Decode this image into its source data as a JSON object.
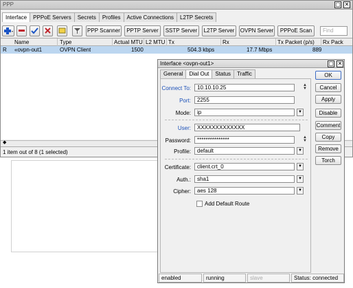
{
  "main_window": {
    "title": "PPP",
    "tabs": [
      "Interface",
      "PPPoE Servers",
      "Secrets",
      "Profiles",
      "Active Connections",
      "L2TP Secrets"
    ],
    "toolbar": {
      "buttons": [
        "PPP Scanner",
        "PPTP Server",
        "SSTP Server",
        "L2TP Server",
        "OVPN Server",
        "PPPoE Scan"
      ],
      "find_placeholder": "Find"
    },
    "table": {
      "columns": [
        "Name",
        "Type",
        "Actual MTU",
        "L2 MTU",
        "Tx",
        "Rx",
        "Tx Packet (p/s)",
        "Rx Pack"
      ],
      "rows": [
        {
          "flag": "R",
          "name": "«ovpn-out1",
          "type": "OVPN Client",
          "actual_mtu": "1500",
          "l2_mtu": "",
          "tx": "504.3 kbps",
          "rx": "17.7 Mbps",
          "tx_packet": "889",
          "rx_packet": ""
        }
      ]
    },
    "status_text": "1 item out of 8 (1 selected)"
  },
  "dialog": {
    "title": "Interface <ovpn-out1>",
    "tabs": [
      "General",
      "Dial Out",
      "Status",
      "Traffic"
    ],
    "fields": {
      "connect_to": {
        "label": "Connect To:",
        "value": "10.10.10.25"
      },
      "port": {
        "label": "Port:",
        "value": "2255"
      },
      "mode": {
        "label": "Mode:",
        "value": "ip"
      },
      "user": {
        "label": "User:",
        "value": "XXXXXXXXXXXXX"
      },
      "password": {
        "label": "Password:",
        "value": "***************"
      },
      "profile": {
        "label": "Profile:",
        "value": "default"
      },
      "certificate": {
        "label": "Certificate:",
        "value": "client.crt_0"
      },
      "auth": {
        "label": "Auth.:",
        "value": "sha1"
      },
      "cipher": {
        "label": "Cipher:",
        "value": "aes 128"
      }
    },
    "add_default_route_label": "Add Default Route",
    "buttons": [
      "OK",
      "Cancel",
      "Apply",
      "Disable",
      "Comment",
      "Copy",
      "Remove",
      "Torch"
    ],
    "status": {
      "enabled": "enabled",
      "running": "running",
      "slave": "slave",
      "connection": "Status: connected"
    }
  },
  "colors": {
    "selected_row": "#bcd6f0",
    "label_blue": "#1a4fb8"
  }
}
